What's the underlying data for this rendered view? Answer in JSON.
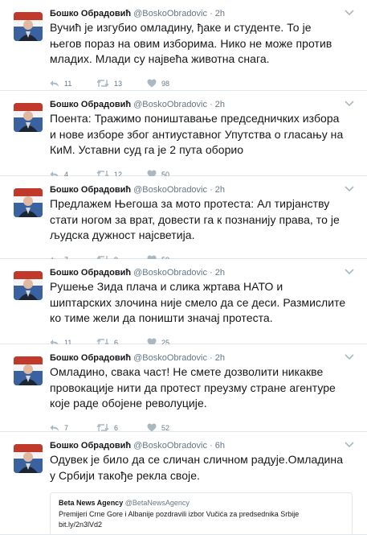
{
  "tweets": [
    {
      "name": "Бошко Обрадовић",
      "handle": "@BoskoObradovic",
      "dot": "·",
      "time": "2h",
      "lines": [
        "Вучић је изгубио омладину, ђаке и студенте. То је",
        "његов пораз на овим изборима. Нико не може против",
        "младих. Млади су највећа животна снага."
      ],
      "replies": "11",
      "retweets": "13",
      "likes": "98"
    },
    {
      "name": "Бошко Обрадовић",
      "handle": "@BoskoObradovic",
      "dot": "·",
      "time": "2h",
      "lines": [
        "Поента: Тражимо поништавање председничких избора",
        "и нове изборе због антиуставног Упутства о гласању на",
        "КиМ. Уставни суд га је 2 пута оборио"
      ],
      "replies": "4",
      "retweets": "12",
      "likes": "50"
    },
    {
      "name": "Бошко Обрадовић",
      "handle": "@BoskoObradovic",
      "dot": "·",
      "time": "2h",
      "lines": [
        "Предлажем Његоша за мото протеста: Ал тирјанству",
        "стати ногом за врат, довести га к познанију права, то је",
        "људска дужност најсветија."
      ],
      "replies": "7",
      "retweets": "9",
      "likes": "50"
    },
    {
      "name": "Бошко Обрадовић",
      "handle": "@BoskoObradovic",
      "dot": "·",
      "time": "2h",
      "lines": [
        "Рушење Зида плача и слика жртава НАТО и",
        "шиптарских злочина није смело да се деси. Размислите",
        "ко тиме жели да поништи значај протеста."
      ],
      "replies": "11",
      "retweets": "6",
      "likes": "25"
    },
    {
      "name": "Бошко Обрадовић",
      "handle": "@BoskoObradovic",
      "dot": "·",
      "time": "2h",
      "lines": [
        "Омладино, свака част! Не смете дозволити никакве",
        "провокације нити да протест преузму стране агентуре",
        "које раде обојене револуције."
      ],
      "replies": "7",
      "retweets": "6",
      "likes": "52"
    },
    {
      "name": "Бошко Обрадовић",
      "handle": "@BoskoObradovic",
      "dot": "·",
      "time": "6h",
      "lines": [
        "Одувек је било да се сличан сличном радује.Омладина",
        "у Србији такође рекла своје."
      ],
      "quote": {
        "name": "Beta News Agency",
        "handle": "@BetaNewsAgency",
        "lines": [
          "Premijeri Crne Gore i Albanije pozdravili izbor Vučića za predsednika Srbije",
          "bit.ly/2n3lVd2"
        ]
      }
    }
  ],
  "icons": {
    "reply": "reply-icon",
    "retweet": "retweet-icon",
    "like": "heart-icon",
    "more": "chevron-down-icon"
  },
  "colors": {
    "text": "#14171a",
    "muted": "#657786",
    "border": "#e1e8ed",
    "icon": "#aab8c2"
  }
}
